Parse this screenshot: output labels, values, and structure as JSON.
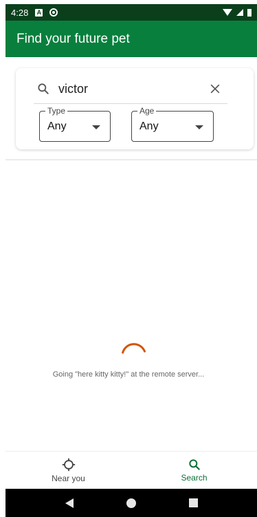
{
  "status_bar": {
    "time": "4:28",
    "badge_letter": "A",
    "icons": [
      "a-badge-icon",
      "sync-circle-icon",
      "wifi-icon",
      "signal-icon",
      "battery-icon"
    ]
  },
  "app_bar": {
    "title": "Find your future pet"
  },
  "search": {
    "query": "victor",
    "icons": {
      "search": "search-icon",
      "clear": "close-icon"
    }
  },
  "filters": {
    "type": {
      "label": "Type",
      "value": "Any"
    },
    "age": {
      "label": "Age",
      "value": "Any"
    }
  },
  "loading": {
    "message": "Going \"here kitty kitty!\" at the remote server...",
    "accent_color": "#d35400"
  },
  "bottom_nav": {
    "items": [
      {
        "label": "Near you",
        "icon": "location-crosshair-icon",
        "active": false
      },
      {
        "label": "Search",
        "icon": "search-icon",
        "active": true
      }
    ]
  },
  "colors": {
    "primary": "#087f3d",
    "primary_dark": "#0b3f1c",
    "nav_active": "#0b6e35"
  }
}
